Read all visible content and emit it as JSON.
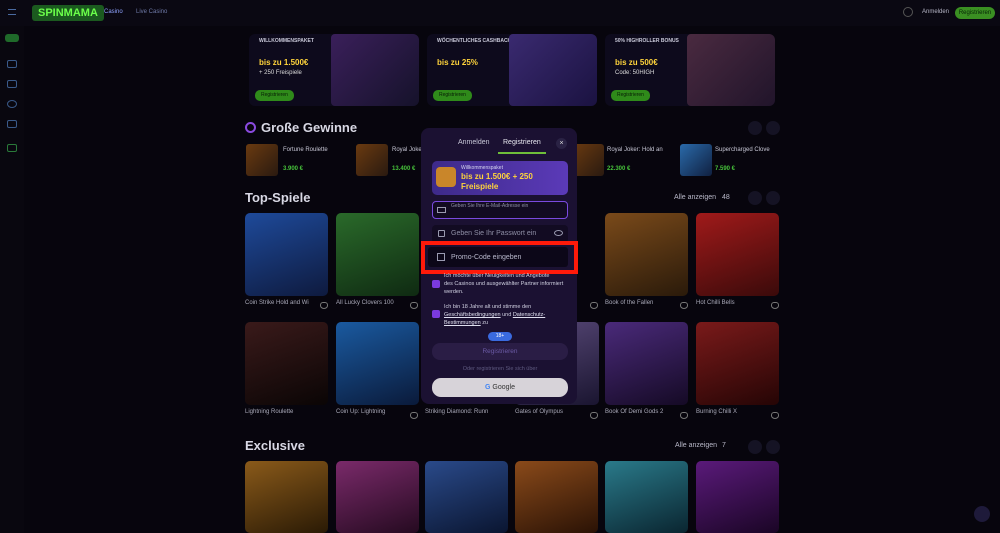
{
  "header": {
    "logo": "SPINMAMA",
    "nav": [
      "Casino",
      "Live Casino"
    ],
    "login_label": "Anmelden",
    "register_label": "Registrieren"
  },
  "promos": [
    {
      "tag": "WILLKOMMENSPAKET",
      "headline": "bis zu 1.500€",
      "sub": "+ 250 Freispiele",
      "button": "Registrieren"
    },
    {
      "tag": "WÖCHENTLICHES CASHBACK",
      "headline": "bis zu 25%",
      "sub": "",
      "button": "Registrieren"
    },
    {
      "tag": "50% HIGHROLLER BONUS",
      "headline": "bis zu 500€",
      "sub": "Code: 50HIGH",
      "button": "Registrieren"
    }
  ],
  "big_wins": {
    "title": "Große Gewinne",
    "items": [
      {
        "name": "Fortune Roulette",
        "amount": "3.900 €"
      },
      {
        "name": "Royal Joker",
        "amount": "13.400 €"
      },
      {
        "name": "Royal Joker: Hold an",
        "amount": "22.300 €"
      },
      {
        "name": "Supercharged Clove",
        "amount": "7.590 €"
      }
    ]
  },
  "top_games": {
    "title": "Top-Spiele",
    "view_all": "Alle anzeigen",
    "count": "48",
    "row1": [
      "Coin Strike Hold and Wi",
      "All Lucky Clovers 100",
      "",
      "",
      "Book of the Fallen",
      "Hot Chilli Bells"
    ],
    "row2": [
      "Lightning Roulette",
      "Coin Up: Lightning",
      "Striking Diamond: Runn",
      "Gates of Olympus",
      "Book Of Demi Gods 2",
      "Burning Chilli X"
    ]
  },
  "exclusive": {
    "title": "Exclusive",
    "view_all": "Alle anzeigen",
    "count": "7"
  },
  "modal": {
    "tab_login": "Anmelden",
    "tab_register": "Registrieren",
    "close": "×",
    "bonus_pre": "Willkommenspaket",
    "bonus_main": "bis zu 1.500€ + 250 Freispiele",
    "email_label": "Geben Sie Ihre E-Mail-Adresse ein",
    "password_placeholder": "Geben Sie Ihr Passwort ein",
    "promo_placeholder": "Promo-Code eingeben",
    "consent1_a": "Ich möchte über Neuigkeiten und Angebote",
    "consent1_b": "des Casinos und ausgewählter Partner informiert werden.",
    "consent2_a": "Ich bin 18 Jahre alt und stimme den",
    "terms_link": "Geschäftsbedingungen",
    "consent2_and": "und",
    "privacy_link": "Datenschutz-Bestimmungen",
    "consent2_end": "zu",
    "badge": "18+",
    "register_button": "Registrieren",
    "or_text": "Oder registrieren Sie sich über",
    "google_button": "Google"
  },
  "colors": {
    "accent": "#6ebd3a",
    "highlight": "#ff1a0a",
    "bonus_yellow": "#ffd43b"
  }
}
